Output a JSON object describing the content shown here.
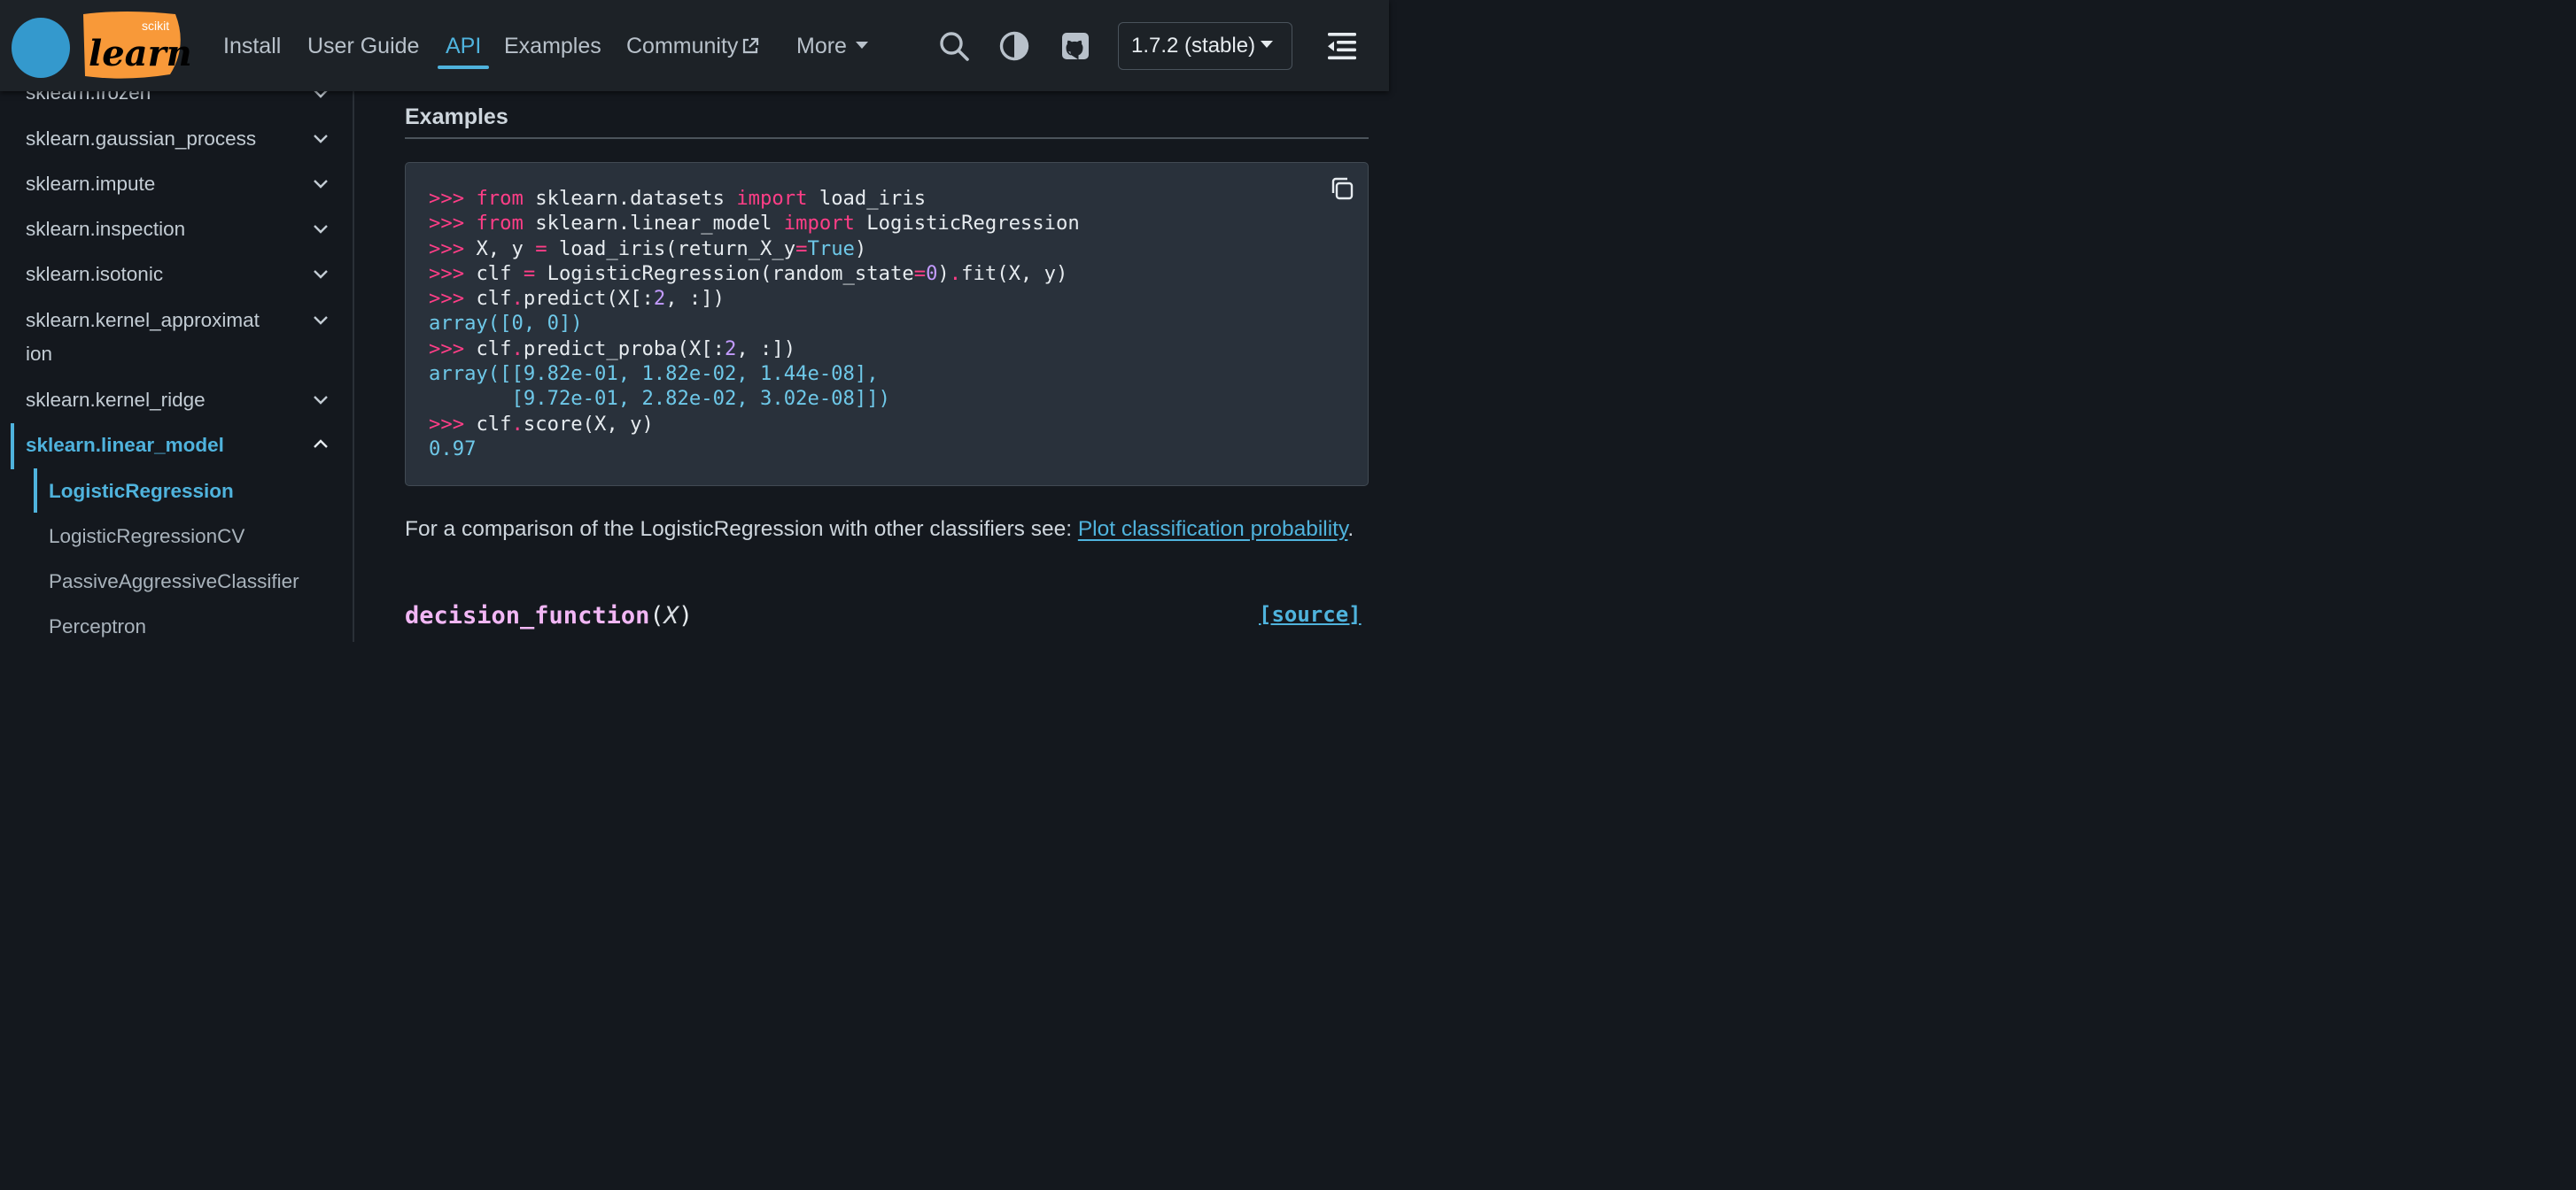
{
  "header": {
    "logo_top_text": "scikit",
    "logo_text": "learn",
    "nav": {
      "install": "Install",
      "user_guide": "User Guide",
      "api": "API",
      "examples": "Examples",
      "community": "Community",
      "more": "More"
    },
    "version": "1.7.2 (stable)",
    "accent_color": "#4fb3dd"
  },
  "sidebar": {
    "items": [
      {
        "label": "sklearn.frozen"
      },
      {
        "label": "sklearn.gaussian_process"
      },
      {
        "label": "sklearn.impute"
      },
      {
        "label": "sklearn.inspection"
      },
      {
        "label": "sklearn.isotonic"
      },
      {
        "label_line1": "sklearn.kernel_approximat",
        "label_line2": "ion"
      },
      {
        "label": "sklearn.kernel_ridge"
      },
      {
        "label": "sklearn.linear_model"
      }
    ],
    "sub_items": [
      {
        "label": "LogisticRegression"
      },
      {
        "label": "LogisticRegressionCV"
      },
      {
        "label": "PassiveAggressiveClassifier"
      },
      {
        "label": "Perceptron"
      }
    ]
  },
  "main": {
    "section_title": "Examples",
    "code": {
      "prompt": ">>>",
      "kw_from": "from",
      "kw_import": "import",
      "line1_mod": "sklearn.datasets",
      "line1_name": "load_iris",
      "line2_mod": "sklearn.linear_model",
      "line2_name": "LogisticRegression",
      "line3_a": "X, y ",
      "eq": "=",
      "line3_b": " load_iris(return_X_y",
      "true_kw": "True",
      "rparen": ")",
      "line4_a": "clf ",
      "line4_b": " LogisticRegression(random_state",
      "zero": "0",
      "dot": ".",
      "line4_c": "fit(X, y)",
      "clf": "clf",
      "line5_a": "predict(X[:",
      "two": "2",
      "slice_end": ", :])",
      "out1": "array([0, 0])",
      "line6_a": "predict_proba(X[:",
      "out2_l1": "array([[9.82e-01, 1.82e-02, 1.44e-08],",
      "out2_l2": "       [9.72e-01, 2.82e-02, 3.02e-08]])",
      "line7_a": "score(X, y)",
      "out3": "0.97"
    },
    "para_text": "For a comparison of the LogisticRegression with other classifiers see: ",
    "para_link": "Plot classification probability",
    "para_end": ".",
    "sig_name": "decision_function",
    "sig_open": "(",
    "sig_arg": "X",
    "sig_close": ")",
    "source_label": "[source]"
  }
}
